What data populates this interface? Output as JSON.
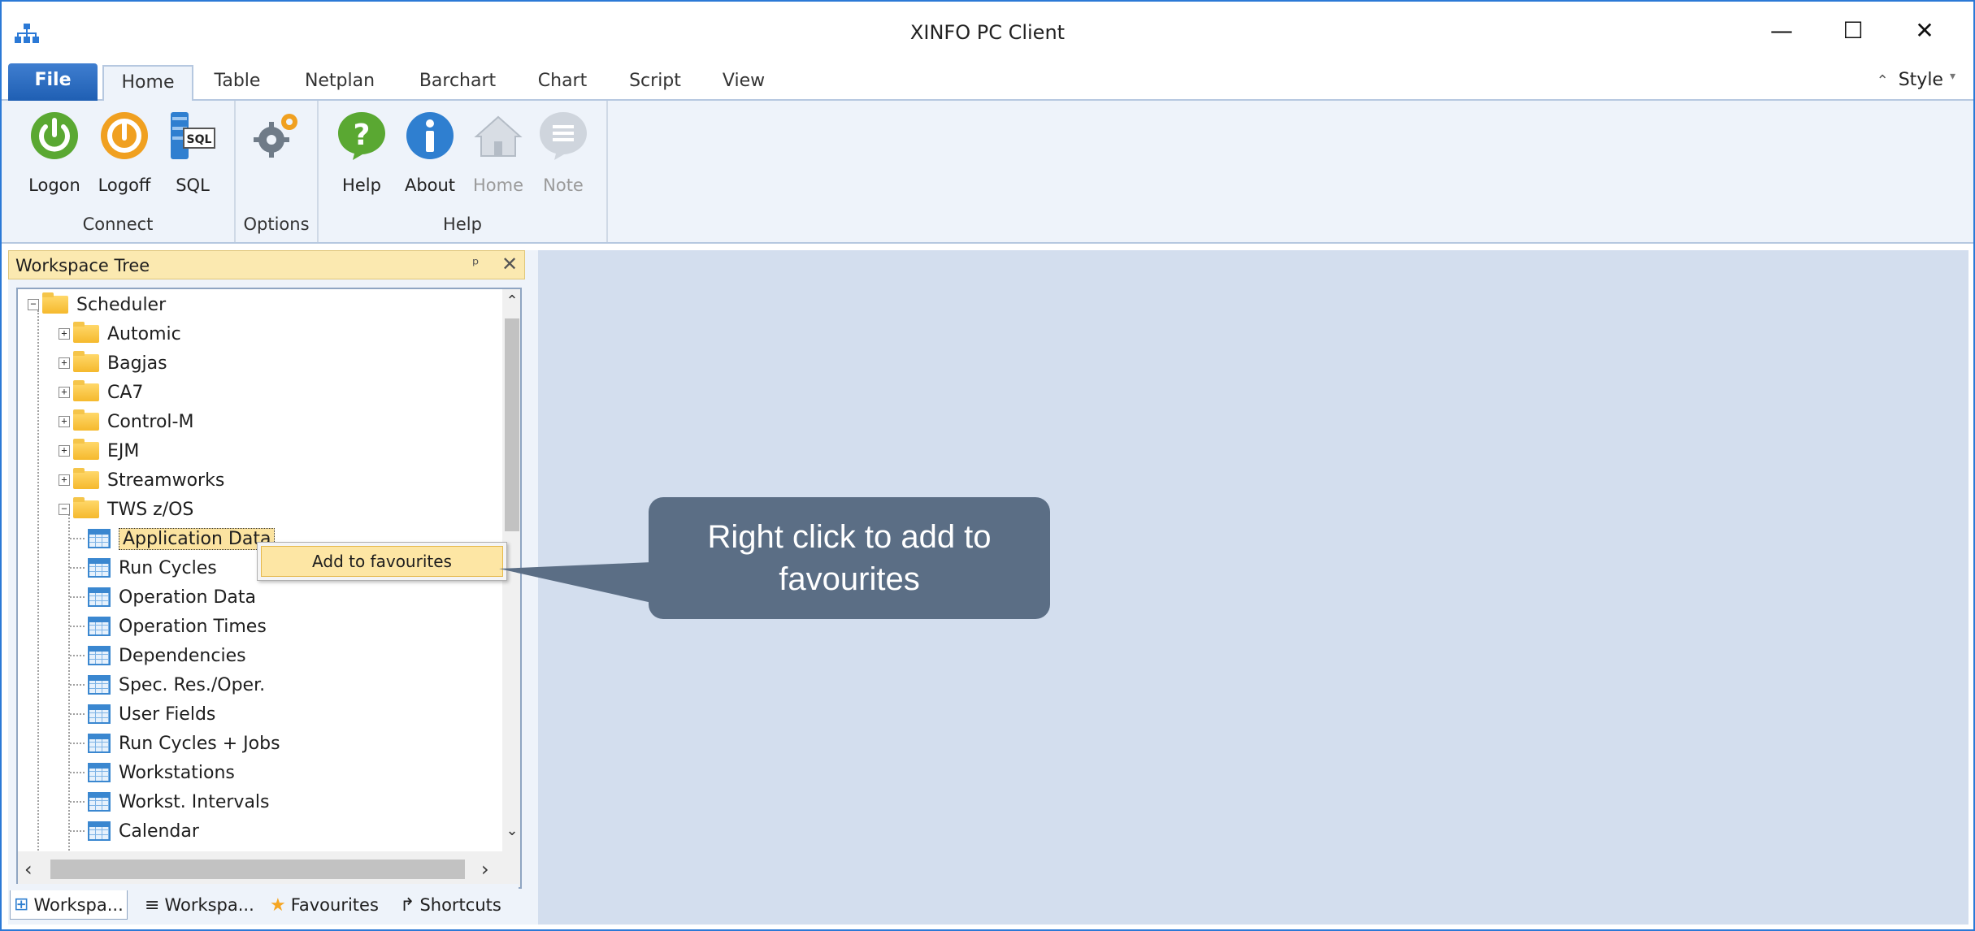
{
  "window": {
    "title": "XINFO PC Client",
    "min_glyph": "—",
    "max_glyph": "☐",
    "close_glyph": "✕"
  },
  "ribbon": {
    "file_tab": "File",
    "tabs": [
      "Home",
      "Table",
      "Netplan",
      "Barchart",
      "Chart",
      "Script",
      "View"
    ],
    "active_tab": "Home",
    "style_label": "Style",
    "groups": {
      "connect": {
        "label": "Connect",
        "buttons": [
          "Logon",
          "Logoff",
          "SQL"
        ]
      },
      "options": {
        "label": "Options"
      },
      "help": {
        "label": "Help",
        "buttons": [
          "Help",
          "About",
          "Home",
          "Note"
        ]
      }
    },
    "sql_icon_text": "SQL"
  },
  "workspace_panel": {
    "title": "Workspace Tree",
    "pin_glyph": "ᵖ",
    "close_glyph": "✕",
    "tree": {
      "root": "Scheduler",
      "folders": [
        "Automic",
        "Bagjas",
        "CA7",
        "Control-M",
        "EJM",
        "Streamworks",
        "TWS z/OS"
      ],
      "tws_items": [
        "Application Data",
        "Run Cycles",
        "Operation Data",
        "Operation Times",
        "Dependencies",
        "Spec. Res./Oper.",
        "User Fields",
        "Run Cycles + Jobs",
        "Workstations",
        "Workst. Intervals",
        "Calendar"
      ]
    },
    "bottom_tabs": [
      "Workspa...",
      "Workspa...",
      "Favourites",
      "Shortcuts"
    ]
  },
  "context_menu": {
    "item": "Add to favourites"
  },
  "callout": {
    "text": "Right click to add to favourites"
  },
  "colors": {
    "accent": "#2b79d6",
    "ribbon_bg": "#eef3fa",
    "main_bg": "#d3deee",
    "callout_bg": "#5b6e85",
    "highlight": "#fde6a4"
  }
}
